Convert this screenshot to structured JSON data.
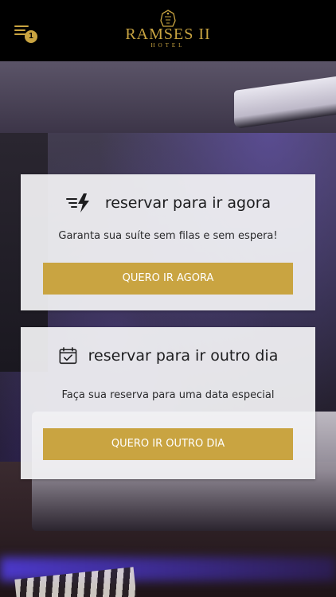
{
  "header": {
    "menu_badge_count": "1",
    "logo_name": "RAMSES II",
    "logo_sub": "HOTEL"
  },
  "cards": [
    {
      "icon": "lightning-icon",
      "title": "reservar para ir agora",
      "description": "Garanta sua suíte sem filas e sem espera!",
      "button_label": "QUERO IR AGORA"
    },
    {
      "icon": "calendar-check-icon",
      "title": "reservar para ir outro dia",
      "description": "Faça sua reserva para uma data especial",
      "button_label": "QUERO IR OUTRO DIA"
    }
  ],
  "colors": {
    "accent_gold": "#c9a441",
    "header_bg": "#000000",
    "card_bg": "#f4f4f6"
  }
}
